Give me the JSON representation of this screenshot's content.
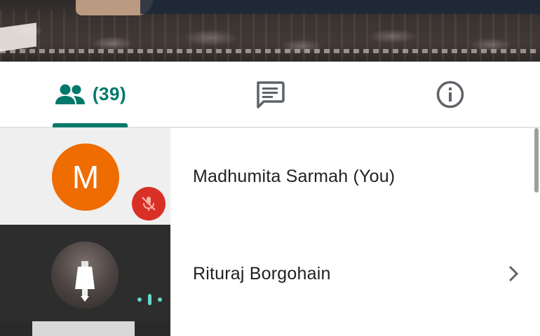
{
  "video": {
    "description_icon": "video-feed"
  },
  "tabs": {
    "people": {
      "icon": "people-icon",
      "count": "(39)",
      "active": true
    },
    "chat": {
      "icon": "chat-icon",
      "active": false
    },
    "info": {
      "icon": "info-icon",
      "active": false
    }
  },
  "participants": [
    {
      "avatar_letter": "M",
      "avatar_color": "#ef6c00",
      "name": "Madhumita Sarmah (You)",
      "status": "muted",
      "status_icon": "mic-off-icon"
    },
    {
      "avatar_letter": "",
      "name": "Rituraj Borgohain",
      "status": "speaking",
      "status_icon": "audio-level-icon",
      "has_chevron": true
    }
  ],
  "colors": {
    "accent": "#00796b",
    "muted_badge": "#d93025",
    "speaking": "#64d8cb"
  }
}
